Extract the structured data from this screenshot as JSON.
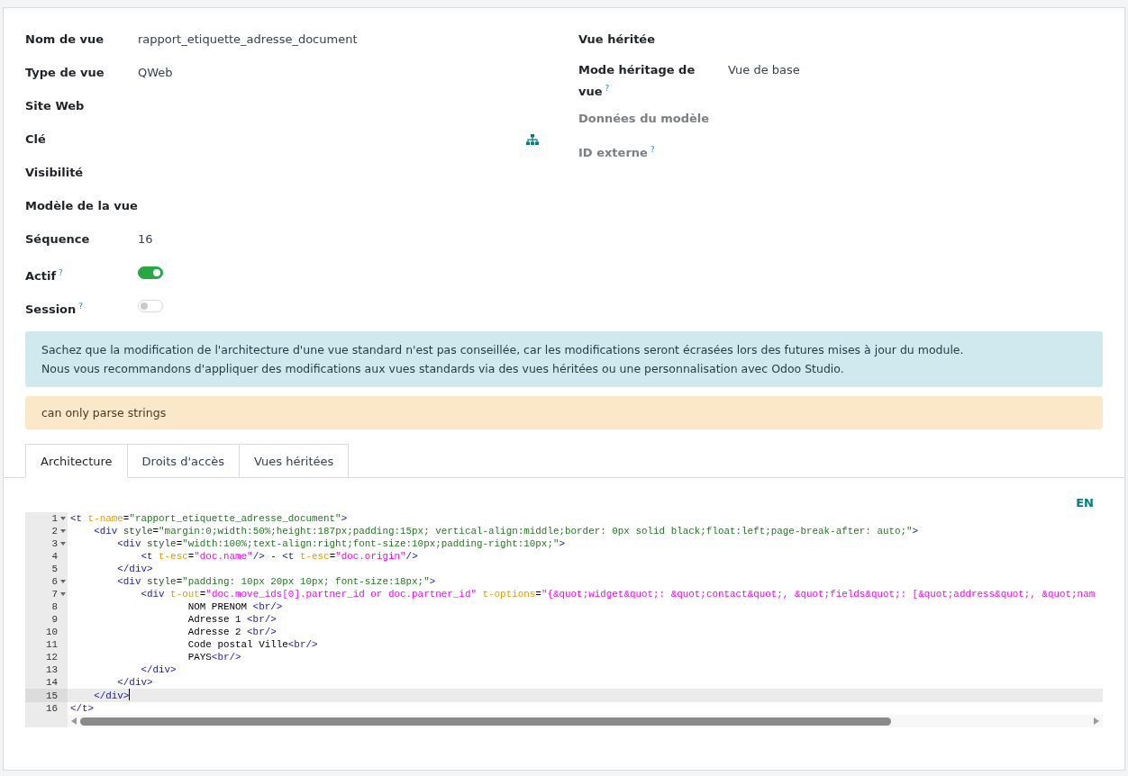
{
  "left_fields": [
    {
      "label": "Nom de vue",
      "kind": "text",
      "value": "rapport_etiquette_adresse_document",
      "muted": false
    },
    {
      "label": "Type de vue",
      "kind": "text",
      "value": "QWeb",
      "muted": false
    },
    {
      "label": "Site Web",
      "kind": "text",
      "muted": false
    },
    {
      "label": "Clé",
      "kind": "tree",
      "muted": false
    },
    {
      "label": "Visibilité",
      "kind": "text",
      "muted": false
    },
    {
      "label": "Modèle de la vue",
      "kind": "text",
      "muted": false
    },
    {
      "label": "Séquence",
      "kind": "text",
      "value": "16",
      "muted": false
    },
    {
      "label": "Actif",
      "help": "?",
      "kind": "toggle",
      "on": true,
      "muted": false
    },
    {
      "label": "Session",
      "help": "?",
      "kind": "toggle",
      "on": false,
      "muted": false
    }
  ],
  "right_fields": [
    {
      "label": "Vue héritée",
      "muted": false
    },
    {
      "label": "Mode héritage de vue",
      "help": "?",
      "value": "Vue de base",
      "muted": false
    },
    {
      "label": "Données du modèle",
      "muted": true
    },
    {
      "label": "ID externe",
      "help": "?",
      "muted": true
    }
  ],
  "alerts": [
    {
      "kind": "info",
      "lines": [
        "Sachez que la modification de l'architecture d'une vue standard n'est pas conseillée, car les modifications seront écrasées lors des futures mises à jour du module.",
        "Nous vous recommandons d'appliquer des modifications aux vues standards via des vues héritées ou une personnalisation avec Odoo Studio."
      ]
    },
    {
      "kind": "warning",
      "lines": [
        "can only parse strings"
      ]
    }
  ],
  "tabs": [
    {
      "label": "Architecture",
      "selected": true
    },
    {
      "label": "Droits d'accès",
      "selected": false
    },
    {
      "label": "Vues héritées",
      "selected": false
    }
  ],
  "editor": {
    "language": "EN",
    "lines": [
      {
        "number": "1",
        "foldable": true,
        "current": false,
        "tokens": [
          {
            "kind": "tag",
            "text": "<t "
          },
          {
            "kind": "attr",
            "text": "t-name"
          },
          {
            "kind": "text",
            "text": "="
          },
          {
            "kind": "string",
            "text": "\"rapport_etiquette_adresse_document\""
          },
          {
            "kind": "tag",
            "text": ">"
          }
        ]
      },
      {
        "number": "2",
        "foldable": true,
        "current": false,
        "tokens": [
          {
            "kind": "tag",
            "text": "    <div "
          },
          {
            "kind": "name",
            "text": "style"
          },
          {
            "kind": "text",
            "text": "="
          },
          {
            "kind": "string",
            "text": "\"margin:0;width:50%;height:187px;padding:15px; vertical-align:middle;border: 0px solid black;float:left;page-break-after: auto;\""
          },
          {
            "kind": "tag",
            "text": ">"
          }
        ]
      },
      {
        "number": "3",
        "foldable": true,
        "current": false,
        "tokens": [
          {
            "kind": "tag",
            "text": "        <div "
          },
          {
            "kind": "name",
            "text": "style"
          },
          {
            "kind": "text",
            "text": "="
          },
          {
            "kind": "string",
            "text": "\"width:100%;text-align:right;font-size:10px;padding-right:10px;\""
          },
          {
            "kind": "tag",
            "text": ">"
          }
        ]
      },
      {
        "number": "4",
        "foldable": false,
        "current": false,
        "tokens": [
          {
            "kind": "tag",
            "text": "            <t "
          },
          {
            "kind": "attr",
            "text": "t-esc"
          },
          {
            "kind": "text",
            "text": "="
          },
          {
            "kind": "expr",
            "text": "\"doc.name\""
          },
          {
            "kind": "tag",
            "text": "/>"
          },
          {
            "kind": "text",
            "text": " - "
          },
          {
            "kind": "tag",
            "text": "<t "
          },
          {
            "kind": "attr",
            "text": "t-esc"
          },
          {
            "kind": "text",
            "text": "="
          },
          {
            "kind": "expr",
            "text": "\"doc.origin\""
          },
          {
            "kind": "tag",
            "text": "/>"
          }
        ]
      },
      {
        "number": "5",
        "foldable": false,
        "current": false,
        "tokens": [
          {
            "kind": "tag",
            "text": "        </div>"
          }
        ]
      },
      {
        "number": "6",
        "foldable": true,
        "current": false,
        "tokens": [
          {
            "kind": "tag",
            "text": "        <div "
          },
          {
            "kind": "name",
            "text": "style"
          },
          {
            "kind": "text",
            "text": "="
          },
          {
            "kind": "string",
            "text": "\"padding: 10px 20px 10px; font-size:18px;\""
          },
          {
            "kind": "tag",
            "text": ">"
          }
        ]
      },
      {
        "number": "7",
        "foldable": true,
        "current": false,
        "tokens": [
          {
            "kind": "tag",
            "text": "            <div "
          },
          {
            "kind": "attr",
            "text": "t-out"
          },
          {
            "kind": "text",
            "text": "="
          },
          {
            "kind": "expr",
            "text": "\"doc.move_ids[0].partner_id or doc.partner_id\" "
          },
          {
            "kind": "attr",
            "text": "t-options"
          },
          {
            "kind": "text",
            "text": "="
          },
          {
            "kind": "expr",
            "text": "\"{&quot;widget&quot;: &quot;contact&quot;, &quot;fields&quot;: [&quot;address&quot;, &quot;nam"
          }
        ]
      },
      {
        "number": "8",
        "foldable": false,
        "current": false,
        "tokens": [
          {
            "kind": "text",
            "text": "                    NOM PRENOM "
          },
          {
            "kind": "tag",
            "text": "<br/>"
          }
        ]
      },
      {
        "number": "9",
        "foldable": false,
        "current": false,
        "tokens": [
          {
            "kind": "text",
            "text": "                    Adresse 1 "
          },
          {
            "kind": "tag",
            "text": "<br/>"
          }
        ]
      },
      {
        "number": "10",
        "foldable": false,
        "current": false,
        "tokens": [
          {
            "kind": "text",
            "text": "                    Adresse 2 "
          },
          {
            "kind": "tag",
            "text": "<br/>"
          }
        ]
      },
      {
        "number": "11",
        "foldable": false,
        "current": false,
        "tokens": [
          {
            "kind": "text",
            "text": "                    Code postal Ville"
          },
          {
            "kind": "tag",
            "text": "<br/>"
          }
        ]
      },
      {
        "number": "12",
        "foldable": false,
        "current": false,
        "tokens": [
          {
            "kind": "text",
            "text": "                    PAYS"
          },
          {
            "kind": "tag",
            "text": "<br/>"
          }
        ]
      },
      {
        "number": "13",
        "foldable": false,
        "current": false,
        "tokens": [
          {
            "kind": "tag",
            "text": "            </div>"
          }
        ]
      },
      {
        "number": "14",
        "foldable": false,
        "current": false,
        "tokens": [
          {
            "kind": "tag",
            "text": "        </div>"
          }
        ]
      },
      {
        "number": "15",
        "foldable": false,
        "current": true,
        "tokens": [
          {
            "kind": "tag",
            "text": "    </div>"
          }
        ]
      },
      {
        "number": "16",
        "foldable": false,
        "current": false,
        "tokens": [
          {
            "kind": "tag",
            "text": "</t>"
          }
        ]
      }
    ]
  }
}
